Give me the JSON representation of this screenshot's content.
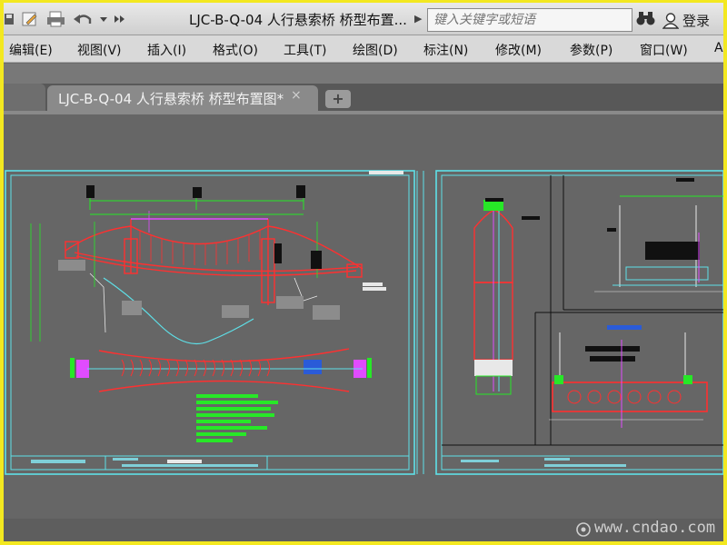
{
  "quick_access": {
    "icons": [
      "save-icon",
      "edit-icon",
      "print-icon",
      "undo-icon",
      "dropdown-icon",
      "more-icon"
    ]
  },
  "title_bar": {
    "document_title": "LJC-B-Q-04 人行悬索桥 桥型布置...",
    "search_placeholder": "键入关键字或短语",
    "login_label": "登录"
  },
  "menu": {
    "items": [
      "编辑(E)",
      "视图(V)",
      "插入(I)",
      "格式(O)",
      "工具(T)",
      "绘图(D)",
      "标注(N)",
      "修改(M)",
      "参数(P)",
      "窗口(W)",
      "A"
    ]
  },
  "tabs": {
    "active_label": "LJC-B-Q-04 人行悬索桥 桥型布置图*",
    "close_symbol": "×",
    "add_symbol": "+"
  },
  "watermark": {
    "text": "www.cndao.com"
  },
  "colors": {
    "drawing_border": "#5ee0e8",
    "cable_red": "#ff3030",
    "dim_green": "#27e827",
    "magenta": "#e04cff",
    "white_line": "#e8e8e8",
    "canvas_bg": "#666666"
  }
}
